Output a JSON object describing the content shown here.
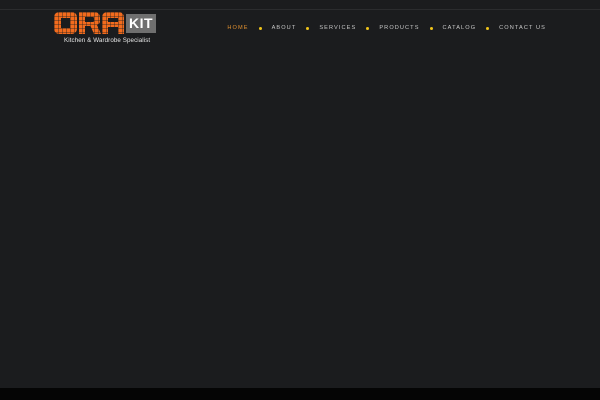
{
  "brand": {
    "logo_letters": "ORA",
    "logo_badge": "KIT",
    "tagline": "Kitchen & Wardrobe Specialist",
    "primary_color": "#f26b1d",
    "badge_color": "#6f6f6f"
  },
  "nav": {
    "items": [
      {
        "label": "HOME",
        "active": true
      },
      {
        "label": "ABOUT",
        "active": false
      },
      {
        "label": "SERVICES",
        "active": false
      },
      {
        "label": "PRODUCTS",
        "active": false
      },
      {
        "label": "CATALOG",
        "active": false
      },
      {
        "label": "CONTACT US",
        "active": false
      }
    ],
    "active_color": "#e0902f",
    "separator_color": "#f0c419"
  },
  "page": {
    "background_color": "#1b1c1e",
    "footer_color": "#050505"
  }
}
